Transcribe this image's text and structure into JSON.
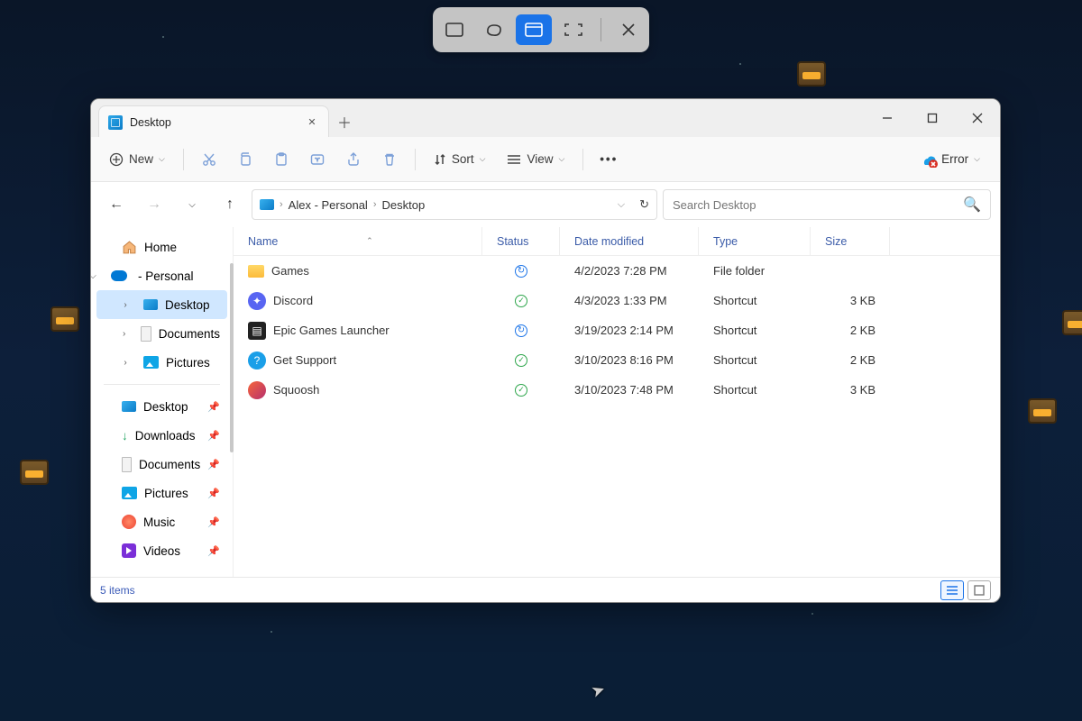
{
  "snip": {
    "tools": [
      "rect",
      "freeform",
      "window",
      "fullscreen",
      "close"
    ]
  },
  "window": {
    "titlebar": {
      "tab_title": "Desktop"
    },
    "toolbar": {
      "new_label": "New",
      "sort_label": "Sort",
      "view_label": "View",
      "error_label": "Error"
    },
    "breadcrumbs": {
      "root": "Alex - Personal",
      "current": "Desktop",
      "search_placeholder": "Search Desktop"
    },
    "sidebar": {
      "home": "Home",
      "personal": "- Personal",
      "desktop": "Desktop",
      "documents": "Documents",
      "pictures": "Pictures",
      "q_desktop": "Desktop",
      "q_downloads": "Downloads",
      "q_documents": "Documents",
      "q_pictures": "Pictures",
      "q_music": "Music",
      "q_videos": "Videos"
    },
    "columns": {
      "name": "Name",
      "status": "Status",
      "date": "Date modified",
      "type": "Type",
      "size": "Size"
    },
    "items": [
      {
        "name": "Games",
        "icon": "folder",
        "status": "sync",
        "date": "4/2/2023 7:28 PM",
        "type": "File folder",
        "size": ""
      },
      {
        "name": "Discord",
        "icon": "discord",
        "status": "ok",
        "date": "4/3/2023 1:33 PM",
        "type": "Shortcut",
        "size": "3 KB"
      },
      {
        "name": "Epic Games Launcher",
        "icon": "epic",
        "status": "sync",
        "date": "3/19/2023 2:14 PM",
        "type": "Shortcut",
        "size": "2 KB"
      },
      {
        "name": "Get Support",
        "icon": "support",
        "status": "ok",
        "date": "3/10/2023 8:16 PM",
        "type": "Shortcut",
        "size": "2 KB"
      },
      {
        "name": "Squoosh",
        "icon": "squoosh",
        "status": "ok",
        "date": "3/10/2023 7:48 PM",
        "type": "Shortcut",
        "size": "3 KB"
      }
    ],
    "statusbar": {
      "count": "5 items"
    }
  }
}
